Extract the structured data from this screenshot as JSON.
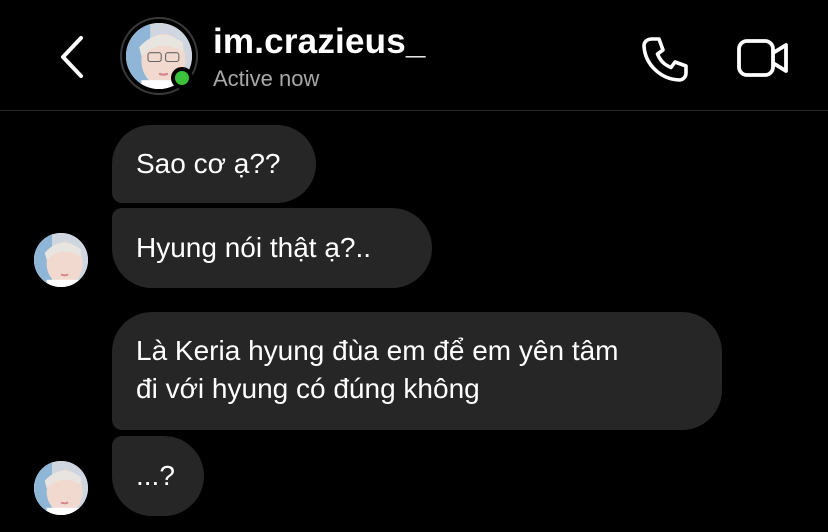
{
  "header": {
    "username": "im.crazieus_",
    "status": "Active now",
    "icons": {
      "back": "chevron-left-icon",
      "call": "phone-icon",
      "video": "video-camera-icon"
    },
    "colors": {
      "online": "#3cc13b",
      "status_text": "#a8a8a8"
    }
  },
  "messages": [
    {
      "sender": "im.crazieus_",
      "text": "Sao cơ ạ??"
    },
    {
      "sender": "im.crazieus_",
      "text": "Hyung nói thật ạ?.."
    },
    {
      "sender": "im.crazieus_",
      "lines": [
        "Là Keria hyung đùa em để em yên tâm",
        "đi với hyung có đúng không"
      ]
    },
    {
      "sender": "im.crazieus_",
      "text": "...?"
    }
  ],
  "colors": {
    "background": "#000000",
    "bubble": "#262626",
    "text": "#ffffff"
  }
}
